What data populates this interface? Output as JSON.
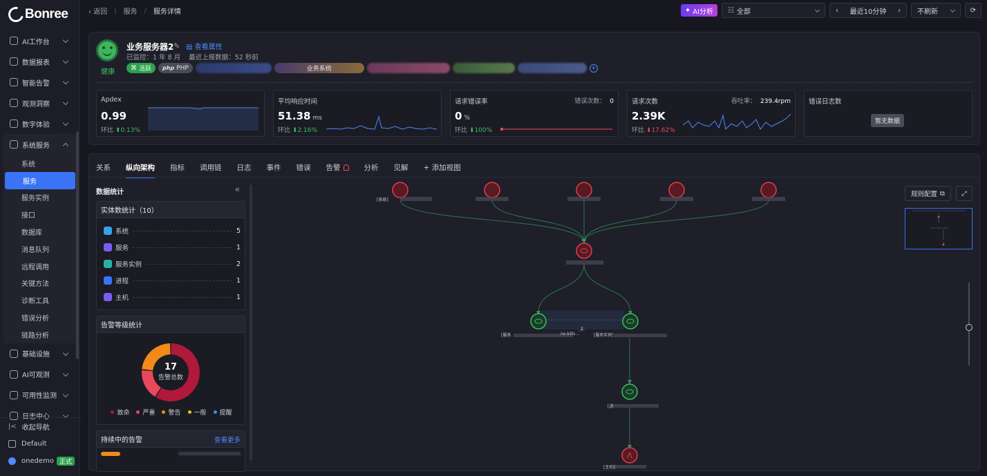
{
  "brand": {
    "name": "Bonree"
  },
  "nav": {
    "items": [
      {
        "label": "AI工作台"
      },
      {
        "label": "数据报表"
      },
      {
        "label": "智能告警"
      },
      {
        "label": "观测洞察"
      },
      {
        "label": "数字体验"
      },
      {
        "label": "系统服务"
      }
    ],
    "sub": [
      "系统",
      "服务",
      "服务实例",
      "接口",
      "数据库",
      "消息队列",
      "远程调用",
      "关键方法",
      "诊断工具",
      "错误分析",
      "链路分析"
    ],
    "after": [
      {
        "label": "基础设施"
      },
      {
        "label": "AI可观测"
      },
      {
        "label": "可用性监测"
      },
      {
        "label": "日志中心"
      }
    ],
    "collapse": "收起导航",
    "workspace": "Default",
    "user": "onedemo",
    "user_tag": "正式"
  },
  "topbar": {
    "back": "返回",
    "crumb1": "服务",
    "crumb2": "服务详情",
    "ai": "AI分析",
    "scope": "全部",
    "time": "最近10分钟",
    "refresh": "不刷新"
  },
  "service": {
    "name": "业务服务器2",
    "view_attr": "查看属性",
    "status": "健康",
    "monitored": "已监控：1 年 8 月",
    "last_report": "最近上报数据：52 秒前",
    "tag_active": "活跃",
    "tag_php": "PHP",
    "tag_blur_text": "业务系统"
  },
  "metrics": {
    "apdex": {
      "title": "Apdex",
      "value": "0.99",
      "cmp_label": "环比",
      "cmp": "0.13%"
    },
    "resp": {
      "title": "平均响应时间",
      "value": "51.38",
      "unit": "ms",
      "cmp_label": "环比",
      "cmp": "2.16%"
    },
    "err": {
      "title": "请求错误率",
      "value": "0",
      "unit": "%",
      "right_label": "错误次数：",
      "right_val": "0",
      "cmp_label": "环比",
      "cmp": "100%"
    },
    "req": {
      "title": "请求次数",
      "value": "2.39K",
      "right_label": "吞吐率：",
      "right_val": "239.4rpm",
      "cmp_label": "环比",
      "cmp": "17.62%"
    },
    "log": {
      "title": "错误日志数",
      "nodata": "暂无数据"
    }
  },
  "tabs": [
    "关系",
    "纵向架构",
    "指标",
    "调用链",
    "日志",
    "事件",
    "错误",
    "告警",
    "分析",
    "见解",
    "+ 添加视图"
  ],
  "stats": {
    "title": "数据统计",
    "entity_title": "实体数统计（10）",
    "entities": [
      {
        "name": "系统",
        "count": "5",
        "color": "#3aa0e8"
      },
      {
        "name": "服务",
        "count": "1",
        "color": "#7b5cf0"
      },
      {
        "name": "服务实例",
        "count": "2",
        "color": "#27b2a6"
      },
      {
        "name": "进程",
        "count": "1",
        "color": "#3b73f5"
      },
      {
        "name": "主机",
        "count": "1",
        "color": "#7b5cf0"
      }
    ],
    "alert_title": "告警等级统计",
    "alert_total": "17",
    "alert_total_label": "告警总数",
    "alert_levels": [
      {
        "name": "致命",
        "color": "#b0183c",
        "value": 10
      },
      {
        "name": "严重",
        "color": "#e8485a",
        "value": 3
      },
      {
        "name": "警告",
        "color": "#f28a1a",
        "value": 4
      },
      {
        "name": "一般",
        "color": "#e8c21a",
        "value": 0
      },
      {
        "name": "提醒",
        "color": "#3b8cf5",
        "value": 0
      }
    ],
    "ongoing_title": "持续中的告警",
    "more": "查看更多"
  },
  "graph": {
    "rule_btn": "规则配置",
    "top_labels": [
      "[系统]",
      "",
      "",
      "",
      ""
    ],
    "svc_label": "",
    "inst1": "[服务",
    "inst1_tail": "no-kills...",
    "inst2": "[服务实例]",
    "link_count": "2",
    "proc": "[进",
    "host": "[主机]"
  }
}
